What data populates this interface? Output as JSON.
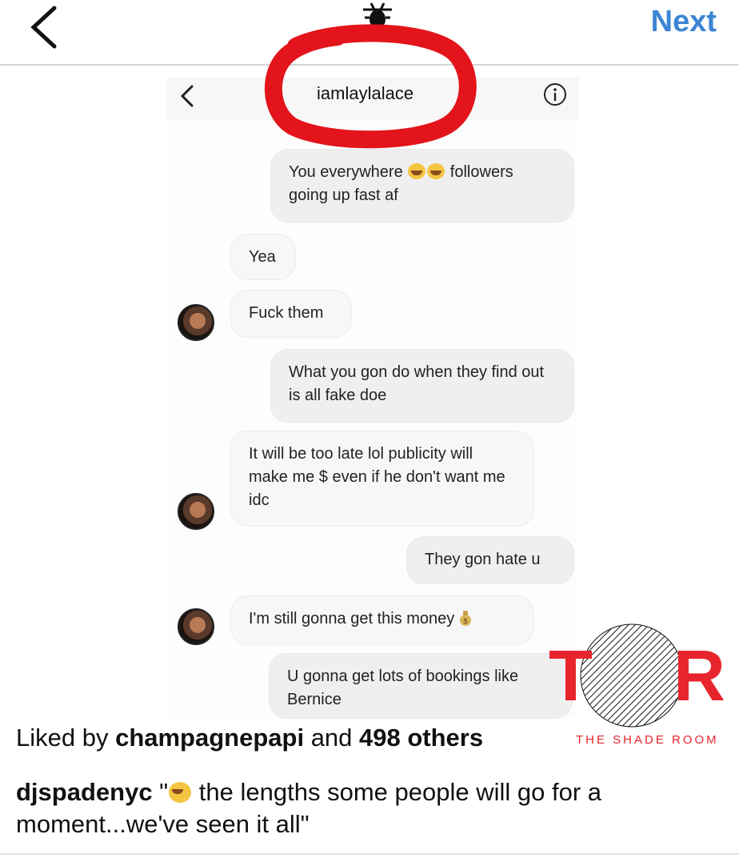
{
  "topbar": {
    "next_label": "Next"
  },
  "conversation": {
    "username": "iamlaylalace",
    "messages": [
      {
        "from": "me",
        "text_before": "You everywhere",
        "text_after": " followers going up fast af"
      },
      {
        "from": "them",
        "text": "Yea"
      },
      {
        "from": "them",
        "text": "Fuck them"
      },
      {
        "from": "me",
        "text": "What you gon do when they find out is all fake doe"
      },
      {
        "from": "them",
        "text": "It will be too late lol publicity will make me $ even if he don't want me idc"
      },
      {
        "from": "me",
        "text": "They gon hate u"
      },
      {
        "from": "them",
        "text": "I'm still gonna get this money"
      },
      {
        "from": "me",
        "text": "U gonna get lots of bookings like Bernice"
      }
    ]
  },
  "logo": {
    "letter_left": "T",
    "letter_right": "R",
    "caption": "THE SHADE ROOM",
    "brand_color": "#e8252d"
  },
  "post": {
    "liked_prefix": "Liked by ",
    "liked_user": "champagnepapi",
    "liked_middle": " and ",
    "liked_count": "498 others",
    "caption_user": "djspadenyc",
    "caption_open": " \"",
    "caption_text": " the lengths some people will go for a moment...we've seen it all\""
  },
  "colors": {
    "accent": "#3d85d4",
    "highlight_red": "#e3141b"
  }
}
